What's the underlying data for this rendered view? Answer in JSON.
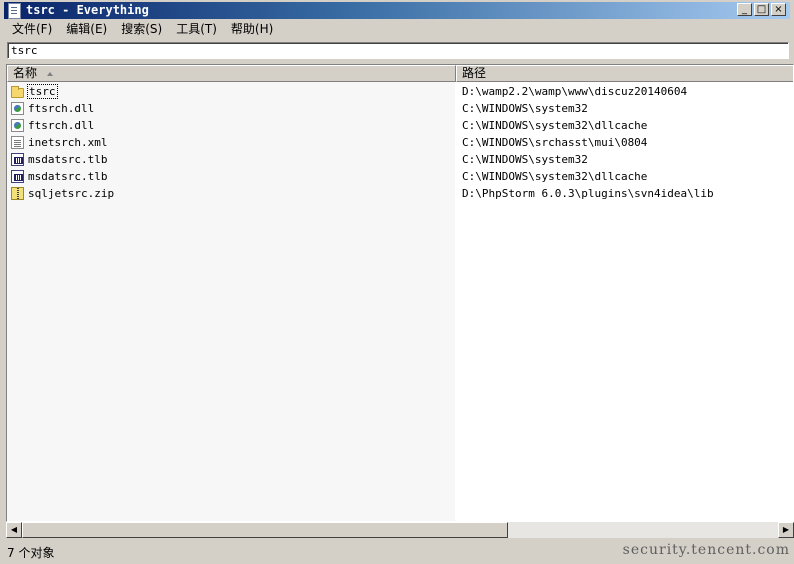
{
  "window": {
    "title": "tsrc - Everything"
  },
  "window_buttons": {
    "minimize": "_",
    "maximize": "□",
    "close": "×"
  },
  "menu": [
    {
      "label": "文件(F)"
    },
    {
      "label": "编辑(E)"
    },
    {
      "label": "搜索(S)"
    },
    {
      "label": "工具(T)"
    },
    {
      "label": "帮助(H)"
    }
  ],
  "search": {
    "value": "tsrc"
  },
  "columns": {
    "name": "名称",
    "path": "路径"
  },
  "rows": [
    {
      "name": "tsrc",
      "path": "D:\\wamp2.2\\wamp\\www\\discuz20140604",
      "icon": "folder-icon"
    },
    {
      "name": "ftsrch.dll",
      "path": "C:\\WINDOWS\\system32",
      "icon": "dll-icon"
    },
    {
      "name": "ftsrch.dll",
      "path": "C:\\WINDOWS\\system32\\dllcache",
      "icon": "dll-icon"
    },
    {
      "name": "inetsrch.xml",
      "path": "C:\\WINDOWS\\srchasst\\mui\\0804",
      "icon": "xml-icon"
    },
    {
      "name": "msdatsrc.tlb",
      "path": "C:\\WINDOWS\\system32",
      "icon": "tlb-icon"
    },
    {
      "name": "msdatsrc.tlb",
      "path": "C:\\WINDOWS\\system32\\dllcache",
      "icon": "tlb-icon"
    },
    {
      "name": "sqljetsrc.zip",
      "path": "D:\\PhpStorm 6.0.3\\plugins\\svn4idea\\lib",
      "icon": "zip-icon"
    }
  ],
  "scrollbar": {
    "left_arrow": "◀",
    "right_arrow": "▶"
  },
  "status": {
    "text": "7 个对象"
  },
  "watermark": "security.tencent.com"
}
